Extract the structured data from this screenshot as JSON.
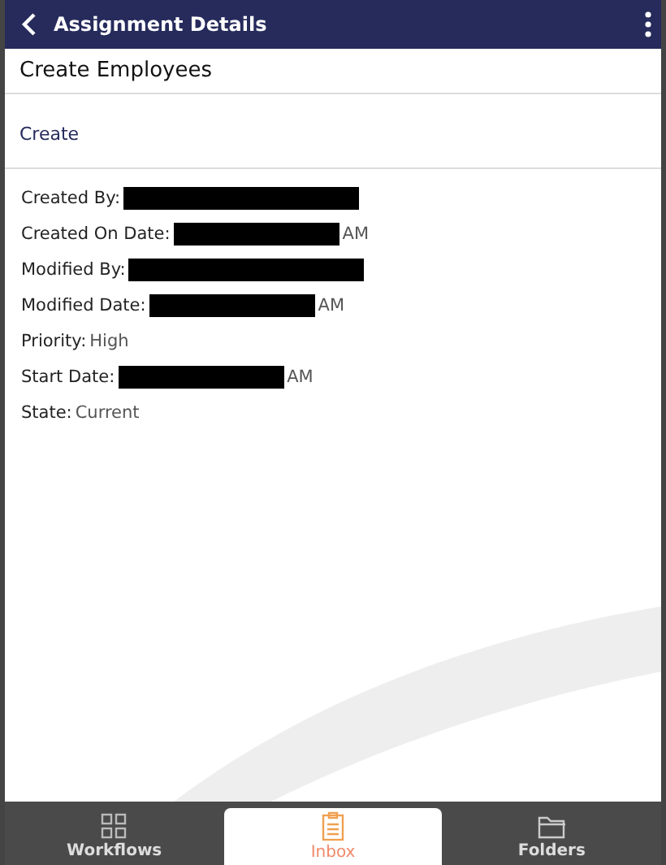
{
  "header": {
    "title": "Assignment Details"
  },
  "page_title": "Create Employees",
  "action_link": "Create",
  "fields": [
    {
      "label": "Created By:",
      "redacted": true
    },
    {
      "label": "Created On Date:",
      "redacted": true,
      "value": "AM"
    },
    {
      "label": "Modified By:",
      "redacted": true
    },
    {
      "label": "Modified Date:",
      "redacted": true,
      "value": "AM"
    },
    {
      "label": "Priority:",
      "redacted": false,
      "value": "High"
    },
    {
      "label": "Start Date:",
      "redacted": true,
      "value": "AM"
    },
    {
      "label": "State:",
      "redacted": false,
      "value": "Current"
    }
  ],
  "tabs": [
    {
      "label": "Workflows",
      "kind": "grid",
      "selected": false
    },
    {
      "label": "Inbox",
      "kind": "clipboard",
      "selected": true
    },
    {
      "label": "Folders",
      "kind": "folder",
      "selected": false
    }
  ]
}
